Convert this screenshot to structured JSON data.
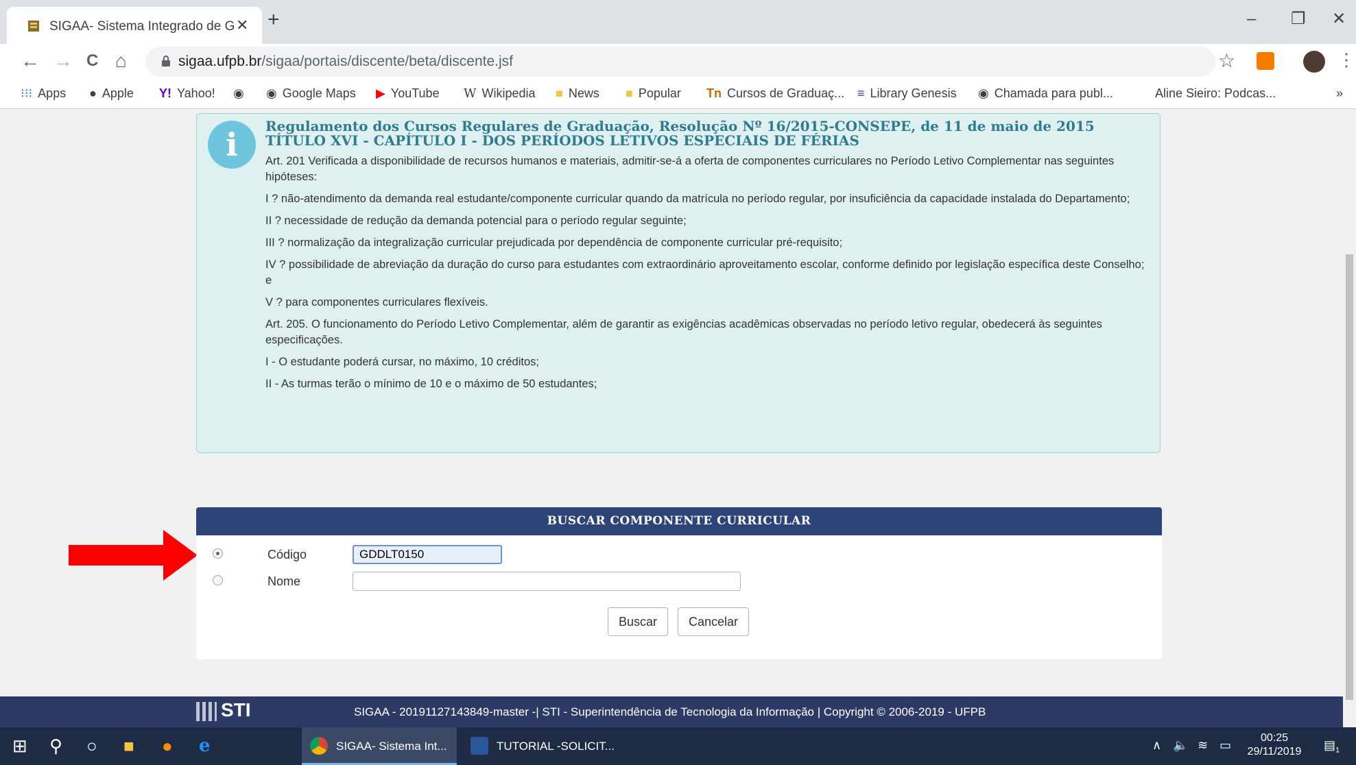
{
  "browser": {
    "tab_title": "SIGAA- Sistema Integrado de Ge",
    "tab_close": "✕",
    "new_tab": "+",
    "url_domain": "sigaa.ufpb.br",
    "url_path": "/sigaa/portais/discente/beta/discente.jsf",
    "window_controls": {
      "minimize": "–",
      "restore": "❐",
      "close": "✕"
    },
    "nav": {
      "back": "←",
      "forward": "→",
      "reload": "C",
      "home": "⌂"
    },
    "star": "☆",
    "menu": "⋮",
    "bookmarks": [
      {
        "label": "Apps",
        "icon": "apps-grid-icon"
      },
      {
        "label": "Apple",
        "icon": "apple-icon"
      },
      {
        "label": "Yahoo!",
        "icon": "yahoo-icon"
      },
      {
        "label": "",
        "icon": "globe-icon"
      },
      {
        "label": "Google Maps",
        "icon": "globe-icon"
      },
      {
        "label": "YouTube",
        "icon": "youtube-icon"
      },
      {
        "label": "Wikipedia",
        "icon": "wikipedia-icon"
      },
      {
        "label": "News",
        "icon": "folder-icon"
      },
      {
        "label": "Popular",
        "icon": "folder-icon"
      },
      {
        "label": "Cursos de Graduaç...",
        "icon": "tn-icon"
      },
      {
        "label": "Library Genesis",
        "icon": "library-icon"
      },
      {
        "label": "Chamada para publ...",
        "icon": "globe-icon"
      },
      {
        "label": "Aline Sieiro: Podcas...",
        "icon": ""
      }
    ],
    "bookmarks_more": "»"
  },
  "info": {
    "icon_letter": "i",
    "title_line1": "Regulamento dos Cursos Regulares de Graduação, Resolução Nº 16/2015-CONSEPE, de 11 de maio de 2015",
    "title_line2": "TÍTULO XVI - CAPÍTULO I - DOS PERÍODOS LETIVOS ESPECIAIS DE FÉRIAS",
    "paragraphs": [
      "Art. 201 Verificada a disponibilidade de recursos humanos e materiais, admitir-se-á a oferta de componentes curriculares no Período Letivo Complementar nas seguintes hipóteses:",
      "I ? não-atendimento da demanda real estudante/componente curricular quando da matrícula no período regular, por insuficiência da capacidade instalada do Departamento;",
      "II ? necessidade de redução da demanda potencial para o período regular seguinte;",
      "III ? normalização da integralização curricular prejudicada por dependência de componente curricular pré-requisito;",
      "IV ? possibilidade de abreviação da duração do curso para estudantes com extraordinário aproveitamento escolar, conforme definido por legislação específica deste Conselho; e",
      "V ? para componentes curriculares flexíveis.",
      "Art. 205. O funcionamento do Período Letivo Complementar, além de garantir as exigências acadêmicas observadas no período letivo regular, obedecerá às seguintes especificações.",
      "I - O estudante poderá cursar, no máximo, 10 créditos;",
      "II - As turmas terão o mínimo de 10 e o máximo de 50 estudantes;"
    ]
  },
  "search": {
    "header": "BUSCAR COMPONENTE CURRICULAR",
    "codigo_label": "Código",
    "codigo_value": "GDDLT0150",
    "nome_label": "Nome",
    "nome_value": "",
    "selected_option": "Código",
    "buscar_label": "Buscar",
    "cancelar_label": "Cancelar"
  },
  "footer": {
    "logo": "STI",
    "text": "SIGAA - 20191127143849-master -| STI - Superintendência de Tecnologia da Informação | Copyright © 2006-2019 - UFPB"
  },
  "taskbar": {
    "apps": [
      {
        "label": "SIGAA- Sistema Int...",
        "icon": "chrome-icon"
      },
      {
        "label": "TUTORIAL -SOLICIT...",
        "icon": "word-icon"
      }
    ],
    "time": "00:25",
    "date": "29/11/2019",
    "notifications": "1"
  },
  "colors": {
    "info_bg": "#dff0f0",
    "info_title": "#2f7b8f",
    "panel_header": "#2d4479",
    "footer_bg": "#2d3a65",
    "arrow": "#ff0000"
  }
}
